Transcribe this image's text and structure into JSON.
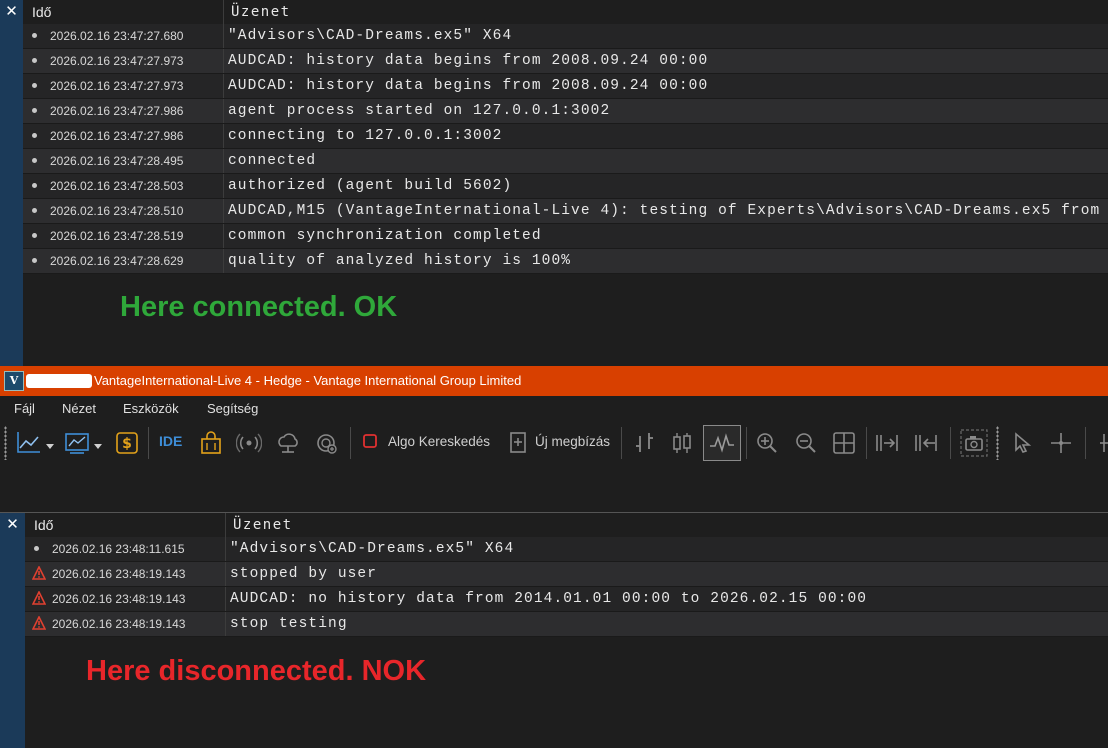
{
  "top_panel": {
    "close_label": "✕",
    "col_time": "Idő",
    "col_message": "Üzenet",
    "rows": [
      {
        "time": "2026.02.16 23:47:27.680",
        "message": "\"Advisors\\CAD-Dreams.ex5\" X64"
      },
      {
        "time": "2026.02.16 23:47:27.973",
        "message": "AUDCAD: history data begins from 2008.09.24 00:00"
      },
      {
        "time": "2026.02.16 23:47:27.973",
        "message": "AUDCAD: history data begins from 2008.09.24 00:00"
      },
      {
        "time": "2026.02.16 23:47:27.986",
        "message": "agent process started on 127.0.0.1:3002"
      },
      {
        "time": "2026.02.16 23:47:27.986",
        "message": "connecting to 127.0.0.1:3002"
      },
      {
        "time": "2026.02.16 23:47:28.495",
        "message": "connected"
      },
      {
        "time": "2026.02.16 23:47:28.503",
        "message": "authorized (agent build 5602)"
      },
      {
        "time": "2026.02.16 23:47:28.510",
        "message": "AUDCAD,M15 (VantageInternational-Live 4): testing of Experts\\Advisors\\CAD-Dreams.ex5 from"
      },
      {
        "time": "2026.02.16 23:47:28.519",
        "message": "common synchronization completed"
      },
      {
        "time": "2026.02.16 23:47:28.629",
        "message": "quality of analyzed history is 100%"
      }
    ],
    "note": "Here connected. OK",
    "note_color": "#2fa83a"
  },
  "window": {
    "title": "VantageInternational-Live 4 - Hedge - Vantage International Group Limited",
    "logo_letter": "V",
    "title_bg": "#d84000",
    "menu": [
      "Fájl",
      "Nézet",
      "Eszközök",
      "Segítség"
    ],
    "toolbar": {
      "ide_label": "IDE",
      "algo_label": "Algo Kereskedés",
      "new_order_label": "Új megbízás",
      "icons": [
        "line-chart-icon",
        "chart-template-icon",
        "dollar-icon",
        "ide-icon",
        "market-bag-icon",
        "signals-icon",
        "cloud-icon",
        "vps-icon",
        "algo-stop-icon",
        "new-order-icon",
        "bar-chart-icon",
        "candle-chart-icon",
        "line-wave-icon",
        "zoom-in-icon",
        "zoom-out-icon",
        "grid-icon",
        "autoscroll-icon",
        "chart-shift-icon",
        "screenshot-icon",
        "cursor-icon",
        "crosshair-icon"
      ]
    }
  },
  "bottom_panel": {
    "close_label": "✕",
    "col_time": "Idő",
    "col_message": "Üzenet",
    "rows": [
      {
        "icon": "bullet",
        "time": "2026.02.16 23:48:11.615",
        "message": "\"Advisors\\CAD-Dreams.ex5\" X64"
      },
      {
        "icon": "warning",
        "time": "2026.02.16 23:48:19.143",
        "message": "stopped by user"
      },
      {
        "icon": "warning",
        "time": "2026.02.16 23:48:19.143",
        "message": "AUDCAD: no history data from 2014.01.01 00:00 to 2026.02.15 00:00"
      },
      {
        "icon": "warning",
        "time": "2026.02.16 23:48:19.143",
        "message": "stop testing"
      }
    ],
    "note": "Here disconnected. NOK",
    "note_color": "#e8262a"
  }
}
